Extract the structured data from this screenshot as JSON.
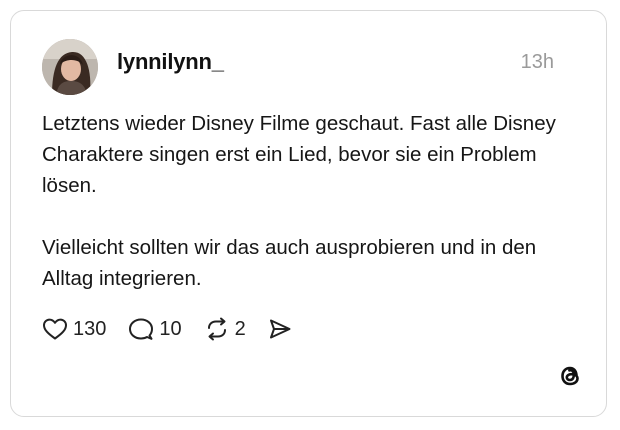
{
  "post": {
    "username": "lynnilynn_",
    "timestamp": "13h",
    "text": "Letztens wieder Disney Filme geschaut. Fast alle Disney Charaktere singen erst ein Lied, bevor sie ein Problem lösen.\n\nVielleicht sollten wir das auch ausprobieren und in den Alltag integrieren."
  },
  "actions": {
    "likes": "130",
    "replies": "10",
    "reposts": "2"
  },
  "icons": {
    "like": "heart-icon",
    "reply": "speech-bubble-icon",
    "repost": "repost-icon",
    "share": "send-icon",
    "brand": "threads-logo-icon"
  },
  "colors": {
    "text": "#111111",
    "muted": "#9a9a9a",
    "border": "#d9d9d9"
  }
}
